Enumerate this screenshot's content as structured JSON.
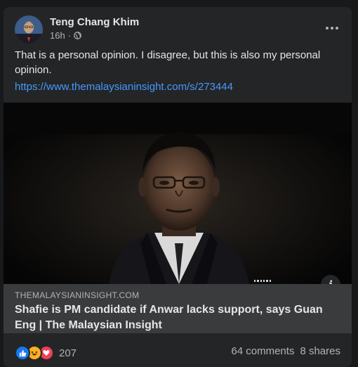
{
  "post": {
    "author": "Teng Chang Khim",
    "time": "16h",
    "audience_icon": "globe-icon",
    "text": "That is a personal opinion. I disagree, but this is also my personal opinion.",
    "link": "https://www.themalaysianinsight.com/s/273444"
  },
  "preview": {
    "domain": "THEMALAYSIANINSIGHT.COM",
    "title": "Shafie is PM candidate if Anwar lacks support, says Guan Eng | The Malaysian Insight",
    "info_icon": "i"
  },
  "footer": {
    "reaction_count": "207",
    "comments": "64 comments",
    "shares": "8 shares"
  },
  "colors": {
    "background": "#18191a",
    "card": "#242526",
    "link": "#4599ff",
    "like": "#1877f2",
    "love": "#f33e58",
    "haha": "#f7b125"
  }
}
